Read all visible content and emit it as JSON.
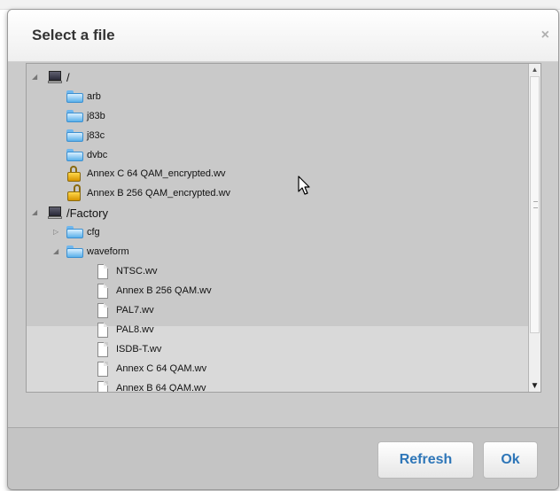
{
  "dialog": {
    "title": "Select a file",
    "close_glyph": "×"
  },
  "tree": {
    "nodes": [
      {
        "label": "/",
        "icon": "drive-icon",
        "toggle": "◢"
      },
      {
        "label": "arb",
        "icon": "folder-icon"
      },
      {
        "label": "j83b",
        "icon": "folder-icon"
      },
      {
        "label": "j83c",
        "icon": "folder-icon"
      },
      {
        "label": "dvbc",
        "icon": "folder-icon"
      },
      {
        "label": "Annex C 64 QAM_encrypted.wv",
        "icon": "lock-icon"
      },
      {
        "label": "Annex B 256 QAM_encrypted.wv",
        "icon": "unlock-icon"
      },
      {
        "label": "/Factory",
        "icon": "drive-icon",
        "toggle": "◢"
      },
      {
        "label": "cfg",
        "icon": "folder-icon",
        "toggle": "▷"
      },
      {
        "label": "waveform",
        "icon": "folder-icon",
        "toggle": "◢"
      },
      {
        "label": "NTSC.wv",
        "icon": "file-icon"
      },
      {
        "label": "Annex B 256 QAM.wv",
        "icon": "file-icon"
      },
      {
        "label": "PAL7.wv",
        "icon": "file-icon"
      },
      {
        "label": "PAL8.wv",
        "icon": "file-icon"
      },
      {
        "label": "ISDB-T.wv",
        "icon": "file-icon"
      },
      {
        "label": "Annex C 64 QAM.wv",
        "icon": "file-icon"
      },
      {
        "label": "Annex B 64 QAM.wv",
        "icon": "file-icon"
      }
    ]
  },
  "scrollbar": {
    "up_glyph": "▲",
    "down_glyph": "▼"
  },
  "footer": {
    "refresh_label": "Refresh",
    "ok_label": "Ok"
  },
  "colors": {
    "accent": "#2e76b8",
    "dialog_bg": "#cfcfcf"
  }
}
